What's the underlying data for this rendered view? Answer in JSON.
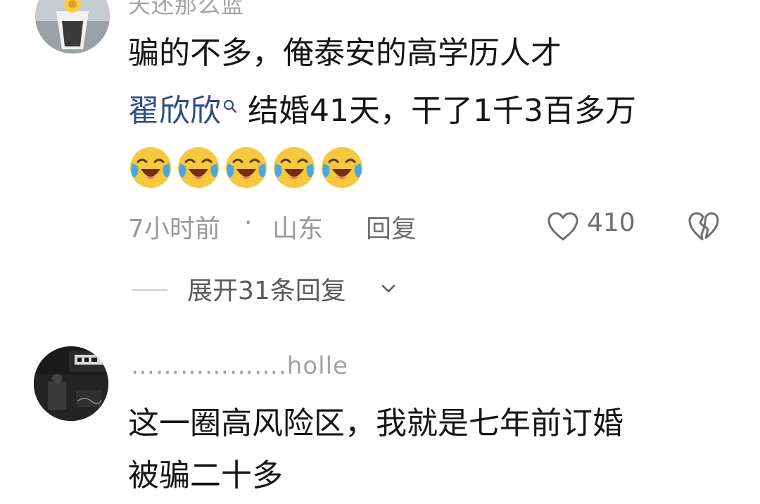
{
  "comments": [
    {
      "username": "天还那么蓝",
      "text_line1": "骗的不多，俺泰安的高学历人才",
      "mention": "翟欣欣",
      "mention_icon": "search-icon",
      "text_line2": "结婚41天，干了1千3百多万",
      "emoji_name": "laughing-crying-emoji",
      "emoji_count": 5,
      "time": "7小时前",
      "separator": "·",
      "location": "山东",
      "reply_label": "回复",
      "like_count": "410",
      "expand_label": "展开31条回复"
    },
    {
      "username": "……………….holle",
      "text_line1": "这一圈高风险区，我就是七年前订婚",
      "text_line2": "被骗二十多"
    }
  ],
  "colors": {
    "mention": "#2d4d87",
    "meta": "#9a9a9a",
    "body_text": "#151515",
    "emoji_face": "#f6c83d",
    "emoji_tears": "#4aa7e6"
  }
}
